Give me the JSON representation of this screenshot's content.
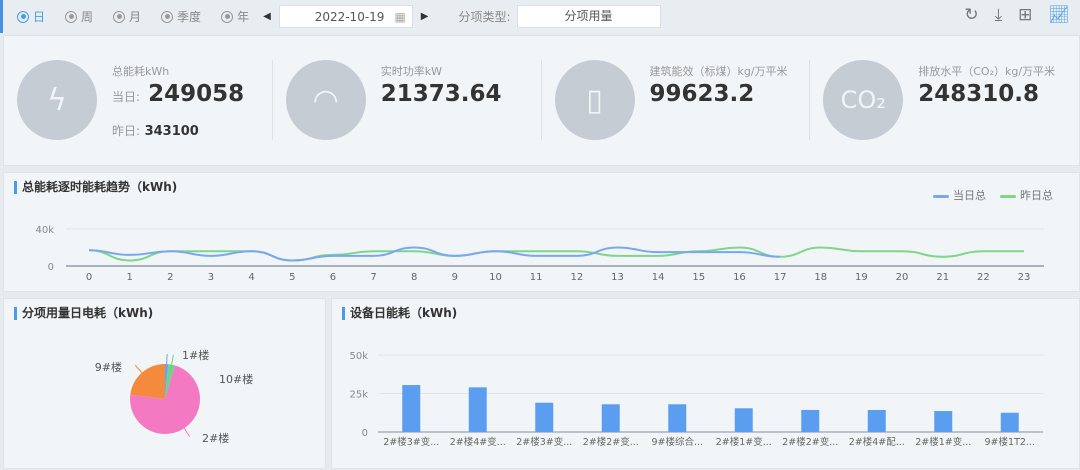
{
  "toolbar": {
    "periods": [
      {
        "label": "日",
        "active": true
      },
      {
        "label": "周"
      },
      {
        "label": "月"
      },
      {
        "label": "季度"
      },
      {
        "label": "年"
      }
    ],
    "date": "2022-10-19",
    "category_label": "分项类型:",
    "category_value": "分项用量"
  },
  "kpis": {
    "total": {
      "label": "总能耗kWh",
      "today_label": "当日:",
      "today": "249058",
      "yesterday_label": "昨日:",
      "yesterday": "343100"
    },
    "power": {
      "label": "实时功率kW",
      "value": "21373.64"
    },
    "building": {
      "label": "建筑能效（标煤）kg/万平米",
      "value": "99623.2"
    },
    "emission": {
      "label": "排放水平（CO₂）kg/万平米",
      "value": "248310.8",
      "icon_text": "CO₂"
    }
  },
  "colors": {
    "accent": "#4a9be8",
    "today": "#7aa7ef",
    "yesterday": "#7dd68a",
    "bar": "#5b9ef0"
  },
  "chart_data": [
    {
      "type": "line",
      "title": "总能耗逐时能耗趋势（kWh)",
      "x": [
        0,
        1,
        2,
        3,
        4,
        5,
        6,
        7,
        8,
        9,
        10,
        11,
        12,
        13,
        14,
        15,
        16,
        17,
        18,
        19,
        20,
        21,
        22,
        23
      ],
      "yticks": [
        "0",
        "40k"
      ],
      "ylim": [
        0,
        40000
      ],
      "legend_position": "top-right",
      "series": [
        {
          "name": "当日总",
          "values": [
            17000,
            12000,
            16000,
            11000,
            16000,
            6000,
            11000,
            11000,
            20000,
            11000,
            16000,
            11000,
            11000,
            20000,
            15000,
            15000,
            15000,
            10000
          ]
        },
        {
          "name": "昨日总",
          "values": [
            17000,
            6000,
            16000,
            16000,
            16000,
            6000,
            12000,
            16000,
            16000,
            11000,
            16000,
            16000,
            16000,
            11000,
            11000,
            16000,
            20000,
            10000,
            20000,
            16000,
            16000,
            10000,
            16000,
            16000
          ]
        }
      ]
    },
    {
      "type": "pie",
      "title": "分项用量日电耗（kWh)",
      "slices": [
        {
          "label": "1#楼",
          "value": 1.5,
          "color": "#6aa4ee"
        },
        {
          "label": "10#楼",
          "value": 3,
          "color": "#6fd28a"
        },
        {
          "label": "2#楼",
          "value": 72.5,
          "color": "#f37ac2"
        },
        {
          "label": "9#楼",
          "value": 23,
          "color": "#f58a3c"
        }
      ]
    },
    {
      "type": "bar",
      "title": "设备日能耗（kWh)",
      "categories": [
        "2#楼3#变...",
        "2#楼4#变...",
        "2#楼3#变...",
        "2#楼2#变...",
        "9#楼综合...",
        "2#楼1#变...",
        "2#楼2#变...",
        "2#楼4#配...",
        "2#楼1#变...",
        "9#楼1T2..."
      ],
      "values": [
        30500,
        29000,
        19000,
        18000,
        18000,
        15400,
        14300,
        14300,
        13600,
        12500
      ],
      "yticks": [
        "0",
        "25k",
        "50k"
      ],
      "ylim": [
        0,
        50000
      ]
    }
  ]
}
